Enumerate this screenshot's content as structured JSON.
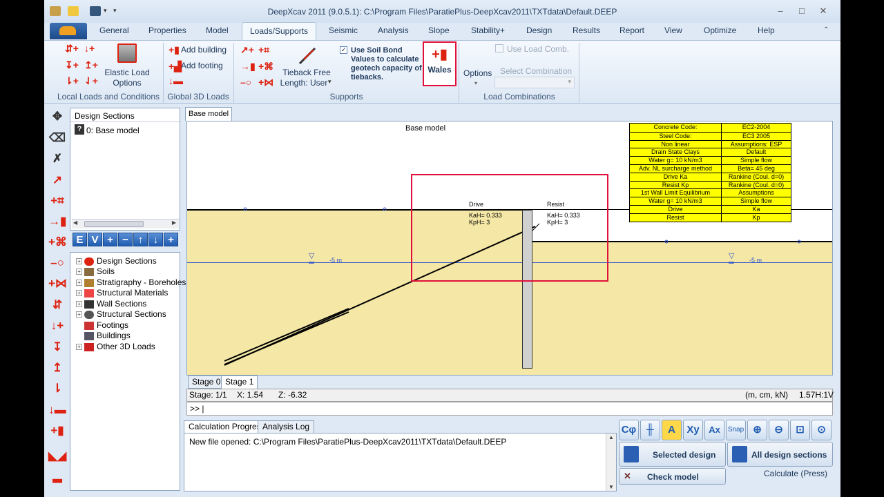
{
  "window": {
    "title": "DeepXcav 2011  (9.0.5.1): C:\\Program Files\\ParatiePlus-DeepXcav2011\\TXTdata\\Default.DEEP"
  },
  "tabs": [
    "General",
    "Properties",
    "Model",
    "Loads/Supports",
    "Seismic",
    "Analysis",
    "Slope",
    "Stability+",
    "Design",
    "Results",
    "Report",
    "View",
    "Optimize",
    "Help"
  ],
  "ribbon": {
    "local_loads": {
      "elastic_label_1": "Elastic Load",
      "elastic_label_2": "Options",
      "group_label": "Local Loads and Conditions"
    },
    "global3d": {
      "add_building": "Add building",
      "add_footing": "Add footing",
      "group_label": "Global 3D Loads"
    },
    "supports": {
      "tieback_label_1": "Tieback Free",
      "tieback_label_2": "Length: User",
      "use_soil_bond_1": "Use Soil Bond",
      "use_soil_bond_2": "Values to calculate",
      "use_soil_bond_3": "geotech capacity of",
      "use_soil_bond_4": "tiebacks.",
      "wales": "Wales",
      "group_label": "Supports"
    },
    "load_comb": {
      "options": "Options",
      "use_load_comb": "Use Load Comb.",
      "select_combination": "Select Combination",
      "group_label": "Load Combinations"
    }
  },
  "design_sections": {
    "header": "Design Sections",
    "items": [
      "0: Base model"
    ]
  },
  "tree": {
    "items": [
      "Design Sections",
      "Soils",
      "Stratigraphy - Boreholes",
      "Structural Materials",
      "Wall Sections",
      "Structural Sections",
      "Footings",
      "Buildings",
      "Other 3D Loads"
    ]
  },
  "drawing": {
    "tab": "Base model",
    "title": "Base model",
    "drive_label": "Drive",
    "resist_label": "Resist",
    "drive_kah": "KaH= 0.333",
    "drive_kph": "KpH= 3",
    "resist_kah": "KaH= 0.333",
    "resist_kph": "KpH= 3",
    "water_left": "-5 m",
    "water_right": "-5 m",
    "info_table": [
      [
        "Concrete Code:",
        "EC2-2004"
      ],
      [
        "Steel Code:",
        "EC3 2005"
      ],
      [
        "Non linear",
        "Assumptions: ESP"
      ],
      [
        "Drain State Clays",
        "Default"
      ],
      [
        "Water g= 10 kN/m3",
        "Simple flow"
      ],
      [
        "Adv. NL surcharge method",
        "Beta= 45 deg"
      ],
      [
        "Drive Ka",
        "Rankine (Coul. d=0)"
      ],
      [
        "Resist Kp",
        "Rankine (Coul. d=0)"
      ],
      [
        "1st Wall Limit Equilibrium",
        "Assumptions"
      ],
      [
        "Water g= 10 kN/m3",
        "Simple flow"
      ],
      [
        "Drive",
        "Ka"
      ],
      [
        "Resist",
        "Kp"
      ]
    ]
  },
  "stages": [
    "Stage 0",
    "Stage 1"
  ],
  "status": {
    "stage": "Stage: 1/1",
    "x": "X: 1.54",
    "z": "Z: -6.32",
    "units": "(m, cm, kN)",
    "scale": "1.57H:1V"
  },
  "cmd": {
    "prompt": ">> |"
  },
  "bottom_tabs": [
    "Calculation Progress",
    "Analysis Log"
  ],
  "log": {
    "text": "New file opened: C:\\Program Files\\ParatiePlus-DeepXcav2011\\TXTdata\\Default.DEEP"
  },
  "calc": {
    "selected": "Selected design",
    "all": "All design sections",
    "check": "Check model",
    "calculate": "Calculate (Press)"
  },
  "toolbar_labels": {
    "snap": "Snap"
  },
  "colors": {
    "soil": "#f5e8a6",
    "accent": "#e0103a",
    "table": "#ffff00"
  }
}
